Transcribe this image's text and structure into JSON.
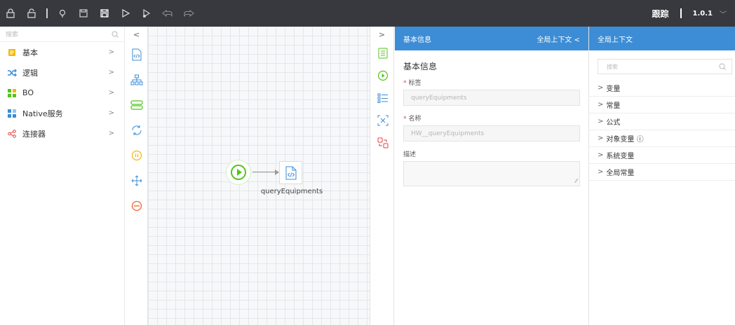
{
  "toolbar": {
    "icons": [
      "lock-icon",
      "unlock-icon",
      "separator",
      "lightbulb-icon",
      "save-icon",
      "save-as-icon",
      "run-icon",
      "debug-icon",
      "undo-icon",
      "redo-icon"
    ],
    "trace_label": "跟踪",
    "version": "1.0.1"
  },
  "left_panel": {
    "search_placeholder": "搜索",
    "categories": [
      {
        "label": "基本",
        "icon": "document-icon",
        "color": "#f5b800"
      },
      {
        "label": "逻辑",
        "icon": "shuffle-icon",
        "color": "#3c8dd5"
      },
      {
        "label": "BO",
        "icon": "grid-icon",
        "color": "#52c41a"
      },
      {
        "label": "Native服务",
        "icon": "grid-icon",
        "color": "#3c8dd5"
      },
      {
        "label": "连接器",
        "icon": "share-icon",
        "color": "#e5413d"
      }
    ]
  },
  "palette": {
    "collapse_glyph": "<"
  },
  "canvas": {
    "node_label": "queryEquipments"
  },
  "right_tabs": {
    "expand_glyph": ">"
  },
  "properties": {
    "header_title": "基本信息",
    "header_link": "全局上下文 <",
    "section_title": "基本信息",
    "label_field": {
      "label": "标签",
      "value": "queryEquipments"
    },
    "name_field": {
      "label": "名称",
      "value": "HW__queryEquipments"
    },
    "desc_field": {
      "label": "描述",
      "value": ""
    }
  },
  "context": {
    "header_title": "全局上下文",
    "search_placeholder": "搜索",
    "items": [
      "变量",
      "常量",
      "公式",
      "对象变量 ⓘ",
      "系统变量",
      "全局常量"
    ]
  },
  "colors": {
    "accent": "#3c8dd5",
    "toolbar_bg": "#37393f",
    "start_green": "#52c41a"
  }
}
